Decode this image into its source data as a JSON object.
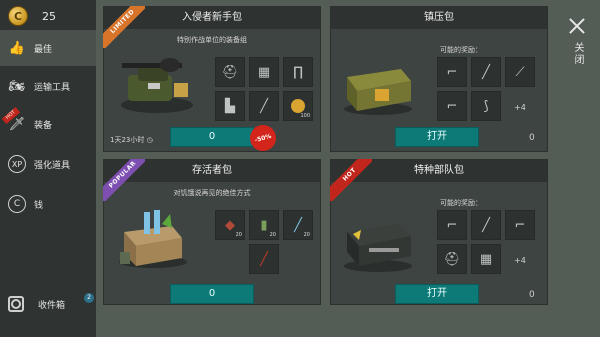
{
  "sidebar": {
    "coins": "25",
    "coin_symbol": "C",
    "items": [
      {
        "label": "最佳",
        "icon": "thumbs-up-icon",
        "glyph": "👍"
      },
      {
        "label": "运输工具",
        "icon": "motorcycle-icon",
        "glyph": "🏍"
      },
      {
        "label": "装备",
        "icon": "equipment-icon",
        "glyph": "🗡",
        "ribbon": "HOT"
      },
      {
        "label": "强化道具",
        "icon": "xp-boost-icon",
        "glyph": "XP"
      },
      {
        "label": "钱",
        "icon": "coin-icon",
        "glyph": "C"
      }
    ],
    "inbox_label": "收件箱",
    "inbox_count": "2"
  },
  "close_label": "关闭",
  "packs": {
    "newbie": {
      "ribbon": "LIMITED",
      "title": "入侵者新手包",
      "subtitle": "特别作战单位的装备组",
      "timer": "1天23小时",
      "price": "0",
      "discount": "-50%",
      "coin_qty": "100"
    },
    "suppress": {
      "title": "镇压包",
      "possible": "可能的奖励：",
      "plus": "+4",
      "open": "打开",
      "price": "0"
    },
    "survivor": {
      "ribbon": "POPULAR",
      "title": "存活者包",
      "subtitle": "对饥饿说再见的绝佳方式",
      "qty1": "20",
      "qty2": "20",
      "qty3": "20",
      "price": "0"
    },
    "special": {
      "ribbon": "HOT",
      "title": "特种部队包",
      "possible": "可能的奖励：",
      "plus": "+4",
      "open": "打开",
      "price": "0"
    }
  },
  "colors": {
    "accent_button": "#0e7a78",
    "limited": "#d8742a",
    "popular": "#7c4fb0",
    "hot": "#c0261c"
  }
}
